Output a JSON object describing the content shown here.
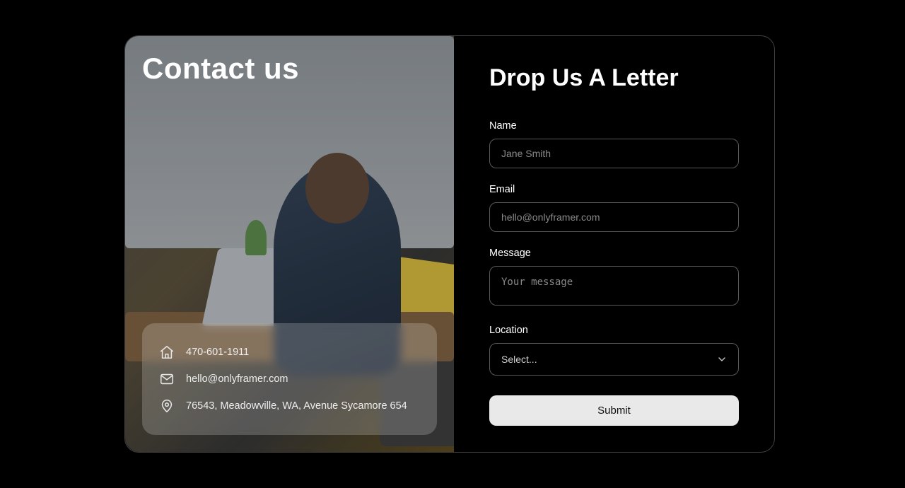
{
  "left": {
    "title": "Contact us",
    "phone": "470-601-1911",
    "email": "hello@onlyframer.com",
    "address": "76543, Meadowville, WA, Avenue Sycamore 654"
  },
  "form": {
    "title": "Drop Us A Letter",
    "name_label": "Name",
    "name_placeholder": "Jane Smith",
    "email_label": "Email",
    "email_placeholder": "hello@onlyframer.com",
    "message_label": "Message",
    "message_placeholder": "Your message",
    "location_label": "Location",
    "location_selected": "Select...",
    "submit_label": "Submit"
  }
}
